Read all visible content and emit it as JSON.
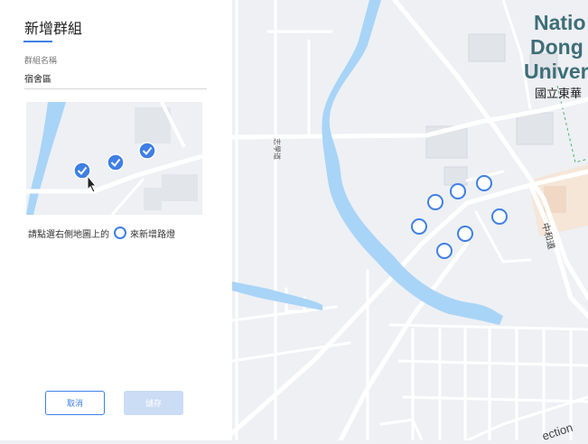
{
  "panel": {
    "title": "新增群組",
    "group_name_label": "群組名稱",
    "group_name_value": "宿舍區",
    "instruction_before": "請點選右側地圖上的",
    "instruction_after": "來新增路燈",
    "cancel_label": "取消",
    "save_label": "儲存"
  },
  "map": {
    "campus_name_lines": [
      "Natio",
      "Dong I",
      "Univer"
    ],
    "campus_name_zh": "國立東華",
    "road_labels": [
      "志學道",
      "中和道",
      "ection"
    ],
    "streetlight_markers": 7
  },
  "colors": {
    "accent": "#3f7fe6",
    "water": "#a8d4f7",
    "road": "#ffffff",
    "land": "#eef0f4",
    "building": "#dee2e7",
    "campus_text": "#3e6e78"
  }
}
